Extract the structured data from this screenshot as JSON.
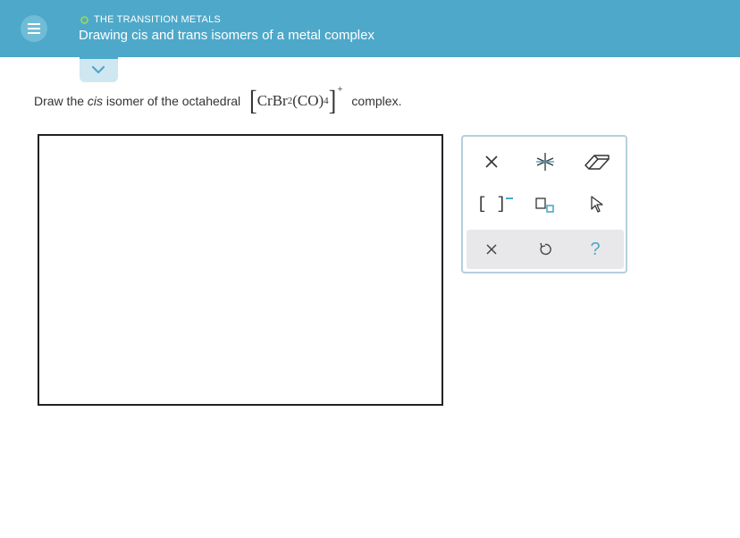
{
  "header": {
    "topic": "THE TRANSITION METALS",
    "title": "Drawing cis and trans isomers of a metal complex"
  },
  "question": {
    "prefix": "Draw the ",
    "emphasis": "cis",
    "middle": " isomer of the octahedral ",
    "formula_a": "CrBr",
    "formula_sub1": "2",
    "formula_b": "(CO)",
    "formula_sub2": "4",
    "charge": "+",
    "suffix": " complex."
  },
  "toolbar": {
    "bracket_charge_label": "[ ]",
    "help_label": "?"
  },
  "colors": {
    "header_bg": "#4ea8c9",
    "accent": "#4ea8c9",
    "topic_dot": "#8fd16b"
  }
}
